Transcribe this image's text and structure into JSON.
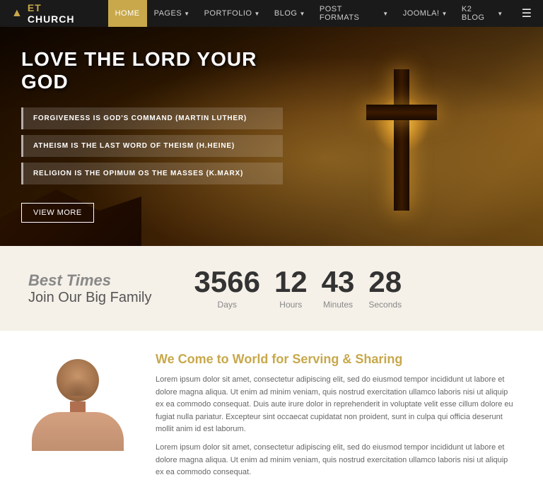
{
  "navbar": {
    "brand": {
      "icon": "▲",
      "name_et": "ET",
      "name_church": " CHURCH"
    },
    "items": [
      {
        "label": "HOME",
        "active": true,
        "has_arrow": false
      },
      {
        "label": "PAGES",
        "active": false,
        "has_arrow": true
      },
      {
        "label": "PORTFOLIO",
        "active": false,
        "has_arrow": true
      },
      {
        "label": "BLOG",
        "active": false,
        "has_arrow": true
      },
      {
        "label": "POST FORMATS",
        "active": false,
        "has_arrow": true
      },
      {
        "label": "JOOMLA!",
        "active": false,
        "has_arrow": true
      },
      {
        "label": "K2 BLOG",
        "active": false,
        "has_arrow": true
      }
    ],
    "hamburger": "☰"
  },
  "hero": {
    "title": "LOVE THE LORD YOUR GOD",
    "quotes": [
      "FORGIVENESS IS GOD'S COMMAND (Martin Luther)",
      "ATHEISM IS THE LAST WORD OF THEISM (H.Heine)",
      "RELIGION IS THE OPIMUM OS THE MASSES (K.Marx)"
    ],
    "button_label": "View More"
  },
  "countdown": {
    "heading1": "Best Times",
    "heading2": "Join Our Big Family",
    "units": [
      {
        "value": "3566",
        "label": "Days"
      },
      {
        "value": "12",
        "label": "Hours"
      },
      {
        "value": "43",
        "label": "Minutes"
      },
      {
        "value": "28",
        "label": "Seconds"
      }
    ]
  },
  "about": {
    "title": "We Come to World for Serving & Sharing",
    "paragraph1": "Lorem ipsum dolor sit amet, consectetur adipiscing elit, sed do eiusmod tempor incididunt ut labore et dolore magna aliqua. Ut enim ad minim veniam, quis nostrud exercitation ullamco laboris nisi ut aliquip ex ea commodo consequat. Duis aute irure dolor in reprehenderit in voluptate velit esse cillum dolore eu fugiat nulla pariatur. Excepteur sint occaecat cupidatat non proident, sunt in culpa qui officia deserunt mollit anim id est laborum.",
    "paragraph2": "Lorem ipsum dolor sit amet, consectetur adipiscing elit, sed do eiusmod tempor incididunt ut labore et dolore magna aliqua. Ut enim ad minim veniam, quis nostrud exercitation ullamco laboris nisi ut aliquip ex ea commodo consequat."
  }
}
